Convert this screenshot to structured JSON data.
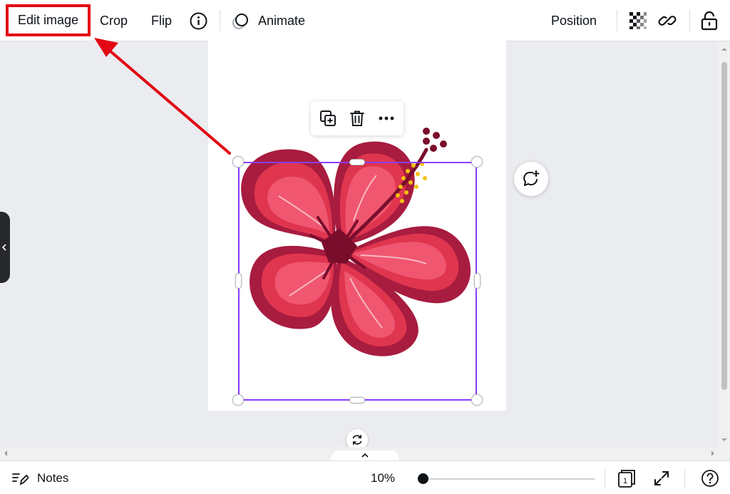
{
  "toolbar": {
    "edit_image": "Edit image",
    "crop": "Crop",
    "flip": "Flip",
    "animate": "Animate",
    "position": "Position"
  },
  "footer": {
    "notes": "Notes",
    "zoom": "10%",
    "pages": "1"
  },
  "icons": {
    "info": "info-icon",
    "animate": "animate-icon",
    "transparency": "transparency-icon",
    "link": "link-icon",
    "lock": "lock-icon",
    "page_lock": "unlock-icon",
    "duplicate_page": "duplicate-icon",
    "add_page": "add-page-icon",
    "element_duplicate": "duplicate-icon",
    "delete": "trash-icon",
    "more": "more-icon",
    "comment": "add-comment-icon",
    "rotate": "rotate-icon",
    "notes": "notes-icon",
    "fullscreen": "fullscreen-icon",
    "help": "help-icon"
  },
  "colors": {
    "selection": "#8b3dff",
    "highlight": "#e30613",
    "petal_dark": "#a81c3f",
    "petal_mid": "#e0354f",
    "petal_light": "#f0566f",
    "stamen": "#f5c211"
  }
}
